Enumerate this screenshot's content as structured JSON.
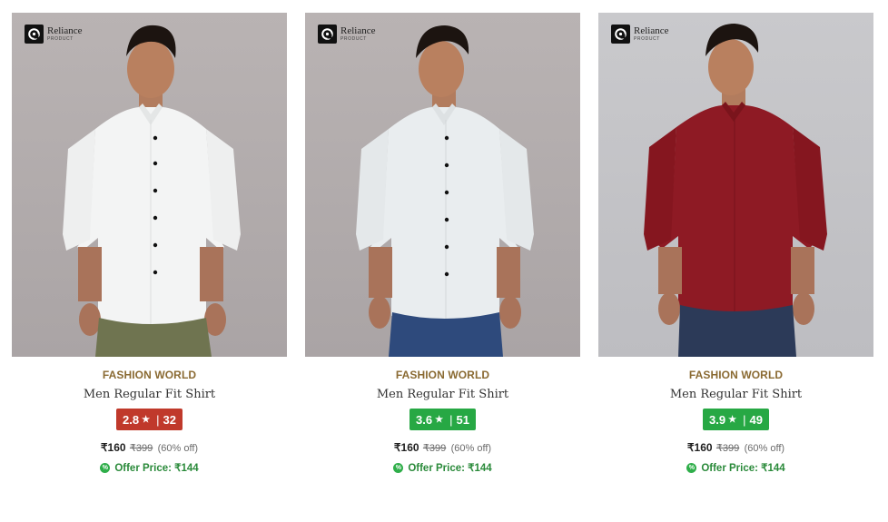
{
  "products": [
    {
      "logo_name": "Reliance",
      "logo_sub": "PRODUCT",
      "brand": "FASHION WORLD",
      "name": "Men Regular Fit Shirt",
      "rating": "2.8",
      "rating_count": "32",
      "price": "₹160",
      "mrp": "₹399",
      "discount": "(60% off)",
      "offer_price": "Offer Price: ₹144",
      "shirt_color": "#f2f3f3",
      "pants_color": "#6f7450",
      "rating_color": "#c0392b"
    },
    {
      "logo_name": "Reliance",
      "logo_sub": "PRODUCT",
      "brand": "FASHION WORLD",
      "name": "Men Regular Fit Shirt",
      "rating": "3.6",
      "rating_count": "51",
      "price": "₹160",
      "mrp": "₹399",
      "discount": "(60% off)",
      "offer_price": "Offer Price: ₹144",
      "shirt_color": "#e9edef",
      "pants_color": "#2e4a7c",
      "rating_color": "#27a844"
    },
    {
      "logo_name": "Reliance",
      "logo_sub": "PRODUCT",
      "brand": "FASHION WORLD",
      "name": "Men Regular Fit Shirt",
      "rating": "3.9",
      "rating_count": "49",
      "price": "₹160",
      "mrp": "₹399",
      "discount": "(60% off)",
      "offer_price": "Offer Price: ₹144",
      "shirt_color": "#8e1a24",
      "pants_color": "#2c3a58",
      "rating_color": "#27a844"
    }
  ]
}
